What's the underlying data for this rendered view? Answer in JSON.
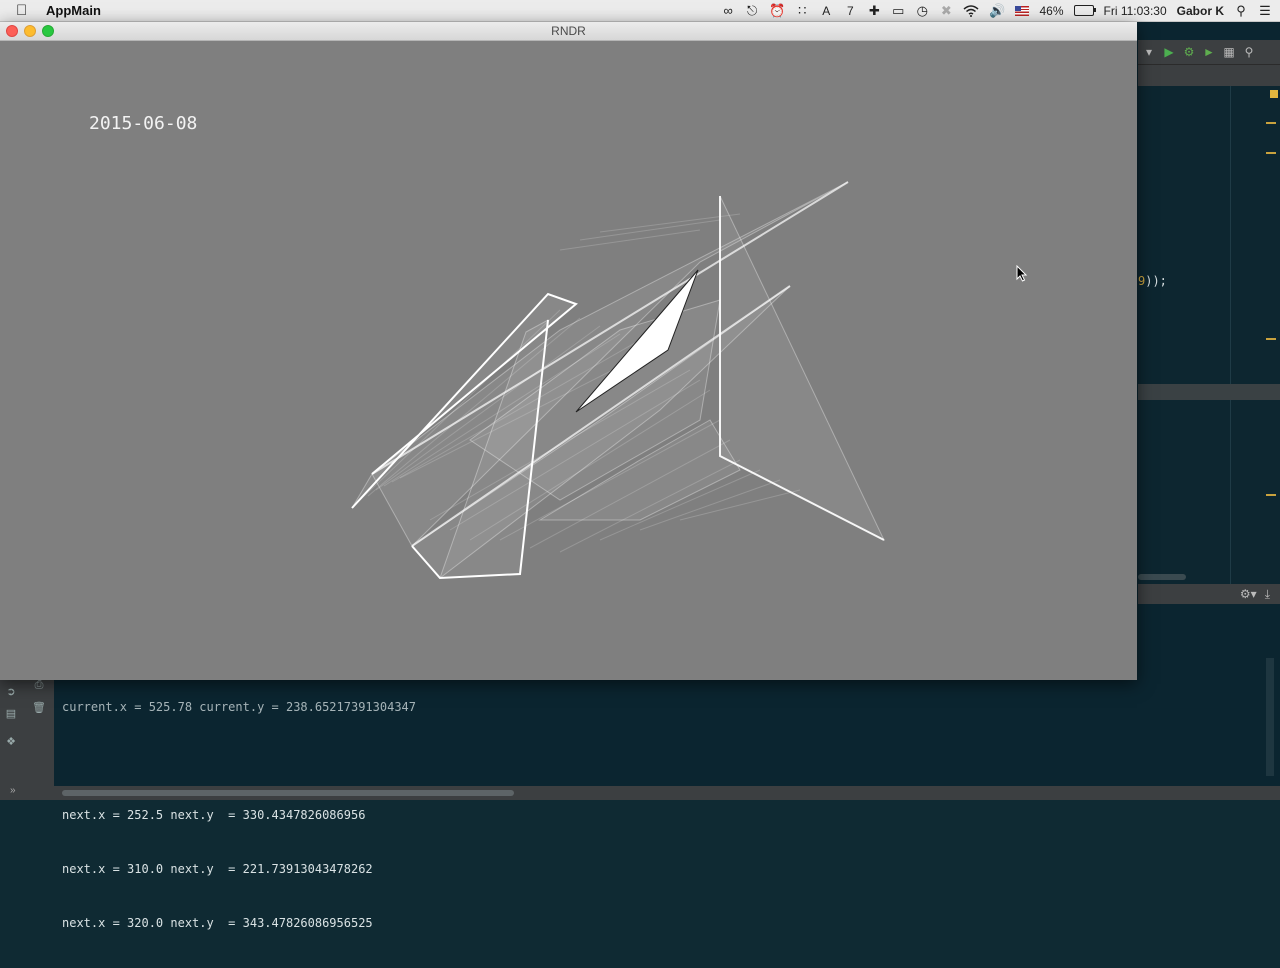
{
  "menubar": {
    "app_name": "AppMain",
    "badge_count": "7",
    "battery": "46%",
    "clock": "Fri 11:03:30",
    "user": "Gabor K",
    "icons": [
      "apple-icon",
      "bandwidth-icon",
      "glasses-icon",
      "alarm-icon",
      "dots-grid-icon",
      "text-tool-icon",
      "plus-icon",
      "airplay-icon",
      "time-machine-icon",
      "bluetooth-icon",
      "wifi-icon",
      "volume-icon",
      "us-flag-icon",
      "battery-icon",
      "search-icon",
      "list-icon"
    ]
  },
  "window": {
    "title": "RNDR",
    "canvas": {
      "date": "2015-06-08"
    }
  },
  "ide": {
    "editor_code_fragment": "9));",
    "console_lines": [
      "current.x = 525.78 current.y = 238.65217391304347",
      "",
      "next.x = 252.5 next.y  = 330.4347826086956",
      "next.x = 310.0 next.y  = 221.73913043478262",
      "next.x = 320.0 next.y  = 343.47826086956525"
    ]
  }
}
